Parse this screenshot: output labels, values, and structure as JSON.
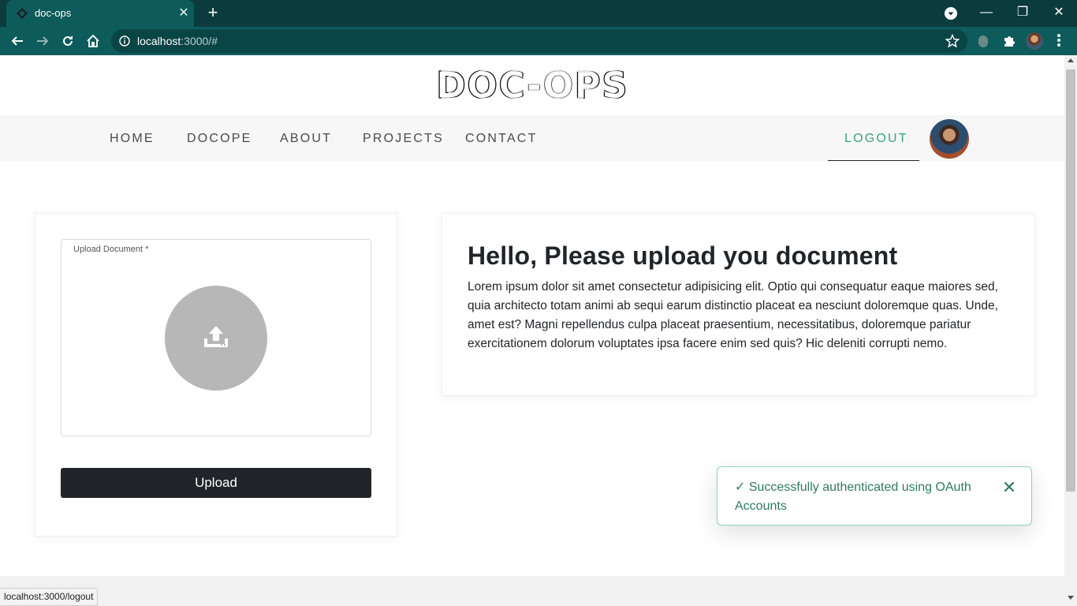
{
  "browser": {
    "tab_title": "doc-ops",
    "url_host": "localhost",
    "url_rest": ":3000/#",
    "status_url": "localhost:3000/logout"
  },
  "brand": {
    "logo_text": "DOC-OPS"
  },
  "nav": {
    "items": [
      {
        "label": "HOME"
      },
      {
        "label": "DOCOPE"
      },
      {
        "label": "ABOUT"
      },
      {
        "label": "PROJECTS"
      },
      {
        "label": "CONTACT"
      }
    ],
    "logout_label": "LOGOUT"
  },
  "upload": {
    "field_label": "Upload Document *",
    "button_label": "Upload"
  },
  "intro": {
    "heading": "Hello, Please upload you document",
    "body": "Lorem ipsum dolor sit amet consectetur adipisicing elit. Optio qui consequatur eaque maiores sed, quia architecto totam animi ab sequi earum distinctio placeat ea nesciunt doloremque quas. Unde, amet est? Magni repellendus culpa placeat praesentium, necessitatibus, doloremque pariatur exercitationem dolorum voluptates ipsa facere enim sed quis? Hic deleniti corrupti nemo."
  },
  "toast": {
    "message": "✓ Successfully authenticated using OAuth Accounts"
  },
  "colors": {
    "tabstrip": "#0b3b3c",
    "toolbar": "#0e5b5c",
    "accent": "#3aa37f",
    "button_dark": "#212529",
    "toast_border": "#8ecfc3"
  },
  "icons": [
    "app-favicon-icon",
    "close-icon",
    "plus-icon",
    "tab-search-icon",
    "minimize-icon",
    "restore-icon",
    "back-icon",
    "forward-icon",
    "reload-icon",
    "home-icon",
    "info-icon",
    "star-icon",
    "extension-icon",
    "puzzle-icon",
    "menu-dots-icon",
    "upload-icon"
  ]
}
